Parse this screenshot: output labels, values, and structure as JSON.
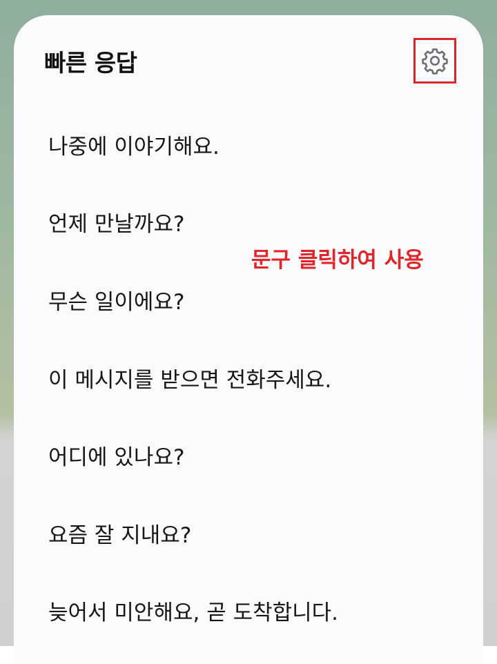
{
  "panel": {
    "title": "빠른 응답",
    "settings_icon": "gear-icon",
    "highlight_color": "#d8262b"
  },
  "replies": [
    "나중에 이야기해요.",
    "언제 만날까요?",
    "무슨 일이에요?",
    "이 메시지를 받으면 전화주세요.",
    "어디에 있나요?",
    "요즘 잘 지내요?",
    "늦어서 미안해요, 곧 도착합니다."
  ],
  "annotation": {
    "text": "문구 클릭하여 사용",
    "color": "#e0262b"
  }
}
